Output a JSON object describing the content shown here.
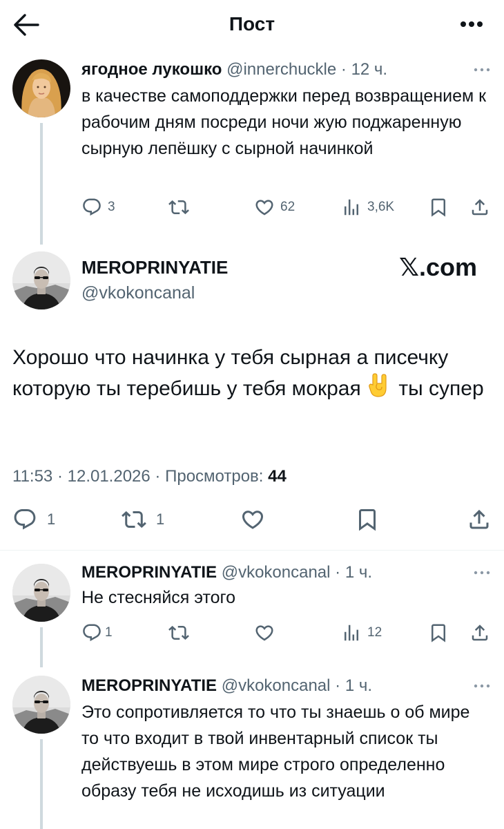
{
  "header": {
    "title": "Пост",
    "back_icon": "arrow-left-icon",
    "more_icon": "more-horizontal-icon"
  },
  "parent_tweet": {
    "name": "ягодное лукошко",
    "handle": "@innerchuckle",
    "sep": "·",
    "time": "12 ч.",
    "text": "в качестве самоподдержки перед возвращением к рабочим дням посреди ночи жую поджаренную сырную лепёшку с сырной начинкой",
    "replies": "3",
    "likes": "62",
    "views": "3,6K"
  },
  "main_tweet": {
    "name": "MEROPRINYATIE",
    "handle": "@vkokoncanal",
    "watermark": "𝕏.com",
    "text_before_emoji": "Хорошо что начинка у тебя сырная а писечку которую ты теребишь у тебя мокрая",
    "emoji_icon": "sign-of-horns-emoji-icon",
    "text_after_emoji": " ты супер",
    "time": "11:53",
    "date": "12.01.2026",
    "sep": "·",
    "views_label": "Просмотров:",
    "views_count": "44",
    "replies": "1",
    "reposts": "1"
  },
  "reply_1": {
    "name": "MEROPRINYATIE",
    "handle": "@vkokoncanal",
    "sep": "·",
    "time": "1 ч.",
    "text": "Не стесняйся этого",
    "replies": "1",
    "views": "12"
  },
  "reply_2": {
    "name": "MEROPRINYATIE",
    "handle": "@vkokoncanal",
    "sep": "·",
    "time": "1 ч.",
    "text": "Это сопротивляется то что ты знаешь о об мире то что входит в твой инвентарный список ты действуешь в этом мире строго определенно образу тебя не исходишь из ситуации"
  },
  "colors": {
    "text": "#0f1419",
    "secondary": "#536471",
    "thread_line": "#cfd9de",
    "divider": "#eff3f4"
  }
}
